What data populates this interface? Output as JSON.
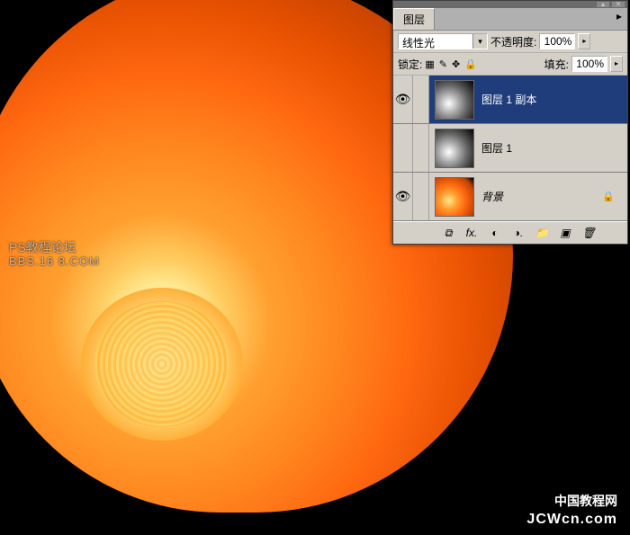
{
  "watermark": {
    "line1": "PS教程论坛",
    "line2": "BBS.16 8.COM",
    "line3": "中国教程网",
    "line4": "JCWcn.com"
  },
  "panel": {
    "tab": "图层",
    "blendmode": "线性光",
    "opacity_label": "不透明度:",
    "opacity_value": "100%",
    "lock_label": "锁定:",
    "fill_label": "填充:",
    "fill_value": "100%"
  },
  "layers": [
    {
      "name": "图层 1 副本",
      "visible": true,
      "selected": true,
      "thumb": "gray",
      "locked": false,
      "italic": false
    },
    {
      "name": "图层 1",
      "visible": false,
      "selected": false,
      "thumb": "gray",
      "locked": false,
      "italic": false
    },
    {
      "name": "背景",
      "visible": true,
      "selected": false,
      "thumb": "color",
      "locked": true,
      "italic": true
    }
  ],
  "icons": {
    "eye": "👁",
    "lock": "🔒",
    "link": "⧉",
    "fx": "fx.",
    "mask": "◐",
    "adjust": "◑.",
    "folder": "📁",
    "new": "▣",
    "trash": "🗑",
    "lock_trans": "▦",
    "lock_brush": "✎",
    "lock_move": "✥",
    "lock_all": "🔒",
    "dd": "▾",
    "play": "▸",
    "menu": "▸"
  }
}
